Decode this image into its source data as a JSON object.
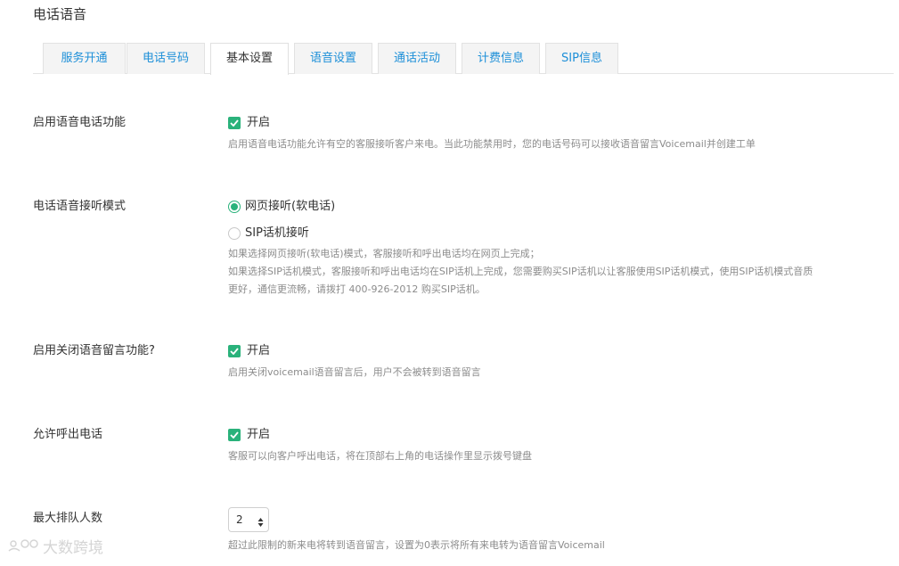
{
  "page": {
    "title": "电话语音"
  },
  "tabs": [
    {
      "label": "服务开通",
      "active": false
    },
    {
      "label": "电话号码",
      "active": false
    },
    {
      "label": "基本设置",
      "active": true
    },
    {
      "label": "语音设置",
      "active": false
    },
    {
      "label": "通话活动",
      "active": false
    },
    {
      "label": "计费信息",
      "active": false
    },
    {
      "label": "SIP信息",
      "active": false
    }
  ],
  "settings": {
    "voice_enable": {
      "label": "启用语音电话功能",
      "checkbox_label": "开启",
      "checked": true,
      "help": "启用语音电话功能允许有空的客服接听客户来电。当此功能禁用时，您的电话号码可以接收语音留言Voicemail并创建工单"
    },
    "answer_mode": {
      "label": "电话语音接听模式",
      "options": [
        {
          "label": "网页接听(软电话)",
          "selected": true
        },
        {
          "label": "SIP话机接听",
          "selected": false
        }
      ],
      "help_lines": [
        "如果选择网页接听(软电话)模式，客服接听和呼出电话均在网页上完成；",
        "如果选择SIP话机模式，客服接听和呼出电话均在SIP话机上完成，您需要购买SIP话机以让客服使用SIP话机模式，使用SIP话机模式音质",
        "更好，通信更流畅，请拨打 400-926-2012 购买SIP话机。"
      ]
    },
    "voicemail": {
      "label": "启用关闭语音留言功能?",
      "checkbox_label": "开启",
      "checked": true,
      "help": "启用关闭voicemail语音留言后，用户不会被转到语音留言"
    },
    "outbound": {
      "label": "允许呼出电话",
      "checkbox_label": "开启",
      "checked": true,
      "help": "客服可以向客户呼出电话，将在顶部右上角的电话操作里显示拨号键盘"
    },
    "queue": {
      "label": "最大排队人数",
      "value": "2",
      "help": "超过此限制的新来电将转到语音留言，设置为0表示将所有来电转为语音留言Voicemail"
    }
  },
  "watermark": {
    "text": "大数跨境"
  },
  "colors": {
    "accent_green": "#2ab27b",
    "tab_link": "#1d8fd8"
  }
}
